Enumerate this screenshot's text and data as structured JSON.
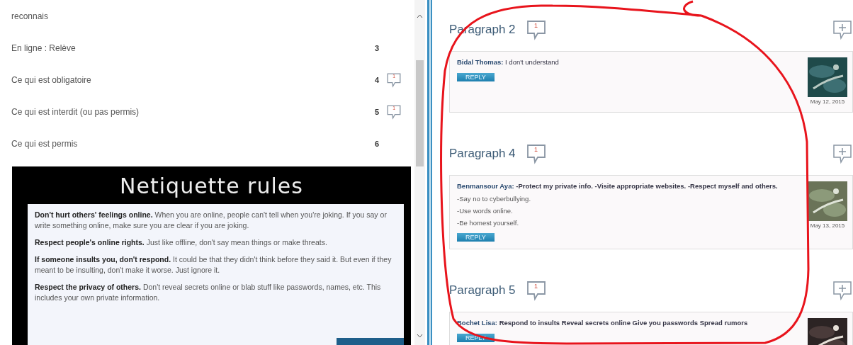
{
  "toc": {
    "rows": [
      {
        "label": "reconnais"
      },
      {
        "label": "En ligne : Relève",
        "number": "3"
      },
      {
        "label": "Ce qui est obligatoire",
        "number": "4",
        "comments": "1"
      },
      {
        "label": "Ce qui est interdit (ou pas permis)",
        "number": "5",
        "comments": "1"
      },
      {
        "label": "Ce qui est permis",
        "number": "6"
      }
    ]
  },
  "slide": {
    "title": "Netiquette rules",
    "rules": [
      "**Don't hurt others' feelings online.** When you are online, people can't tell when you're joking. If you say or write something online, make sure you are clear if you are joking.",
      "**Respect people's online rights.** Just like offline, don't say mean things or make threats.",
      "**If someone insults you, don't respond.** It could be that they didn't think before they said it. But even if they meant to be insulting, don't make it worse. Just ignore it.",
      "**Respect the privacy of others.** Don't reveal secrets online or blab stuff like passwords, names, etc. This includes your own private information."
    ]
  },
  "paragraphs": [
    {
      "title": "Paragraph 2",
      "count": "1",
      "comments": [
        {
          "author": "Bidal Thomas:",
          "text": "I don't understand",
          "bold": false,
          "reply": "REPLY",
          "date": "May 12, 2015"
        }
      ]
    },
    {
      "title": "Paragraph 4",
      "count": "1",
      "comments": [
        {
          "author": "Benmansour Aya:",
          "text": "-Protect my private info. -Visite appropriate websites. -Respect myself and others.",
          "bold": true,
          "lines": [
            "-Say no to cyberbullying.",
            "-Use words online.",
            "-Be homest yourself."
          ],
          "reply": "REPLY",
          "date": "May 13, 2015"
        }
      ]
    },
    {
      "title": "Paragraph 5",
      "count": "1",
      "comments": [
        {
          "author": "Bochet Lisa:",
          "text": "Respond to insults Reveal secrets online Give you passwords Spread rumors",
          "bold": true,
          "reply": "REPLY"
        }
      ]
    }
  ]
}
